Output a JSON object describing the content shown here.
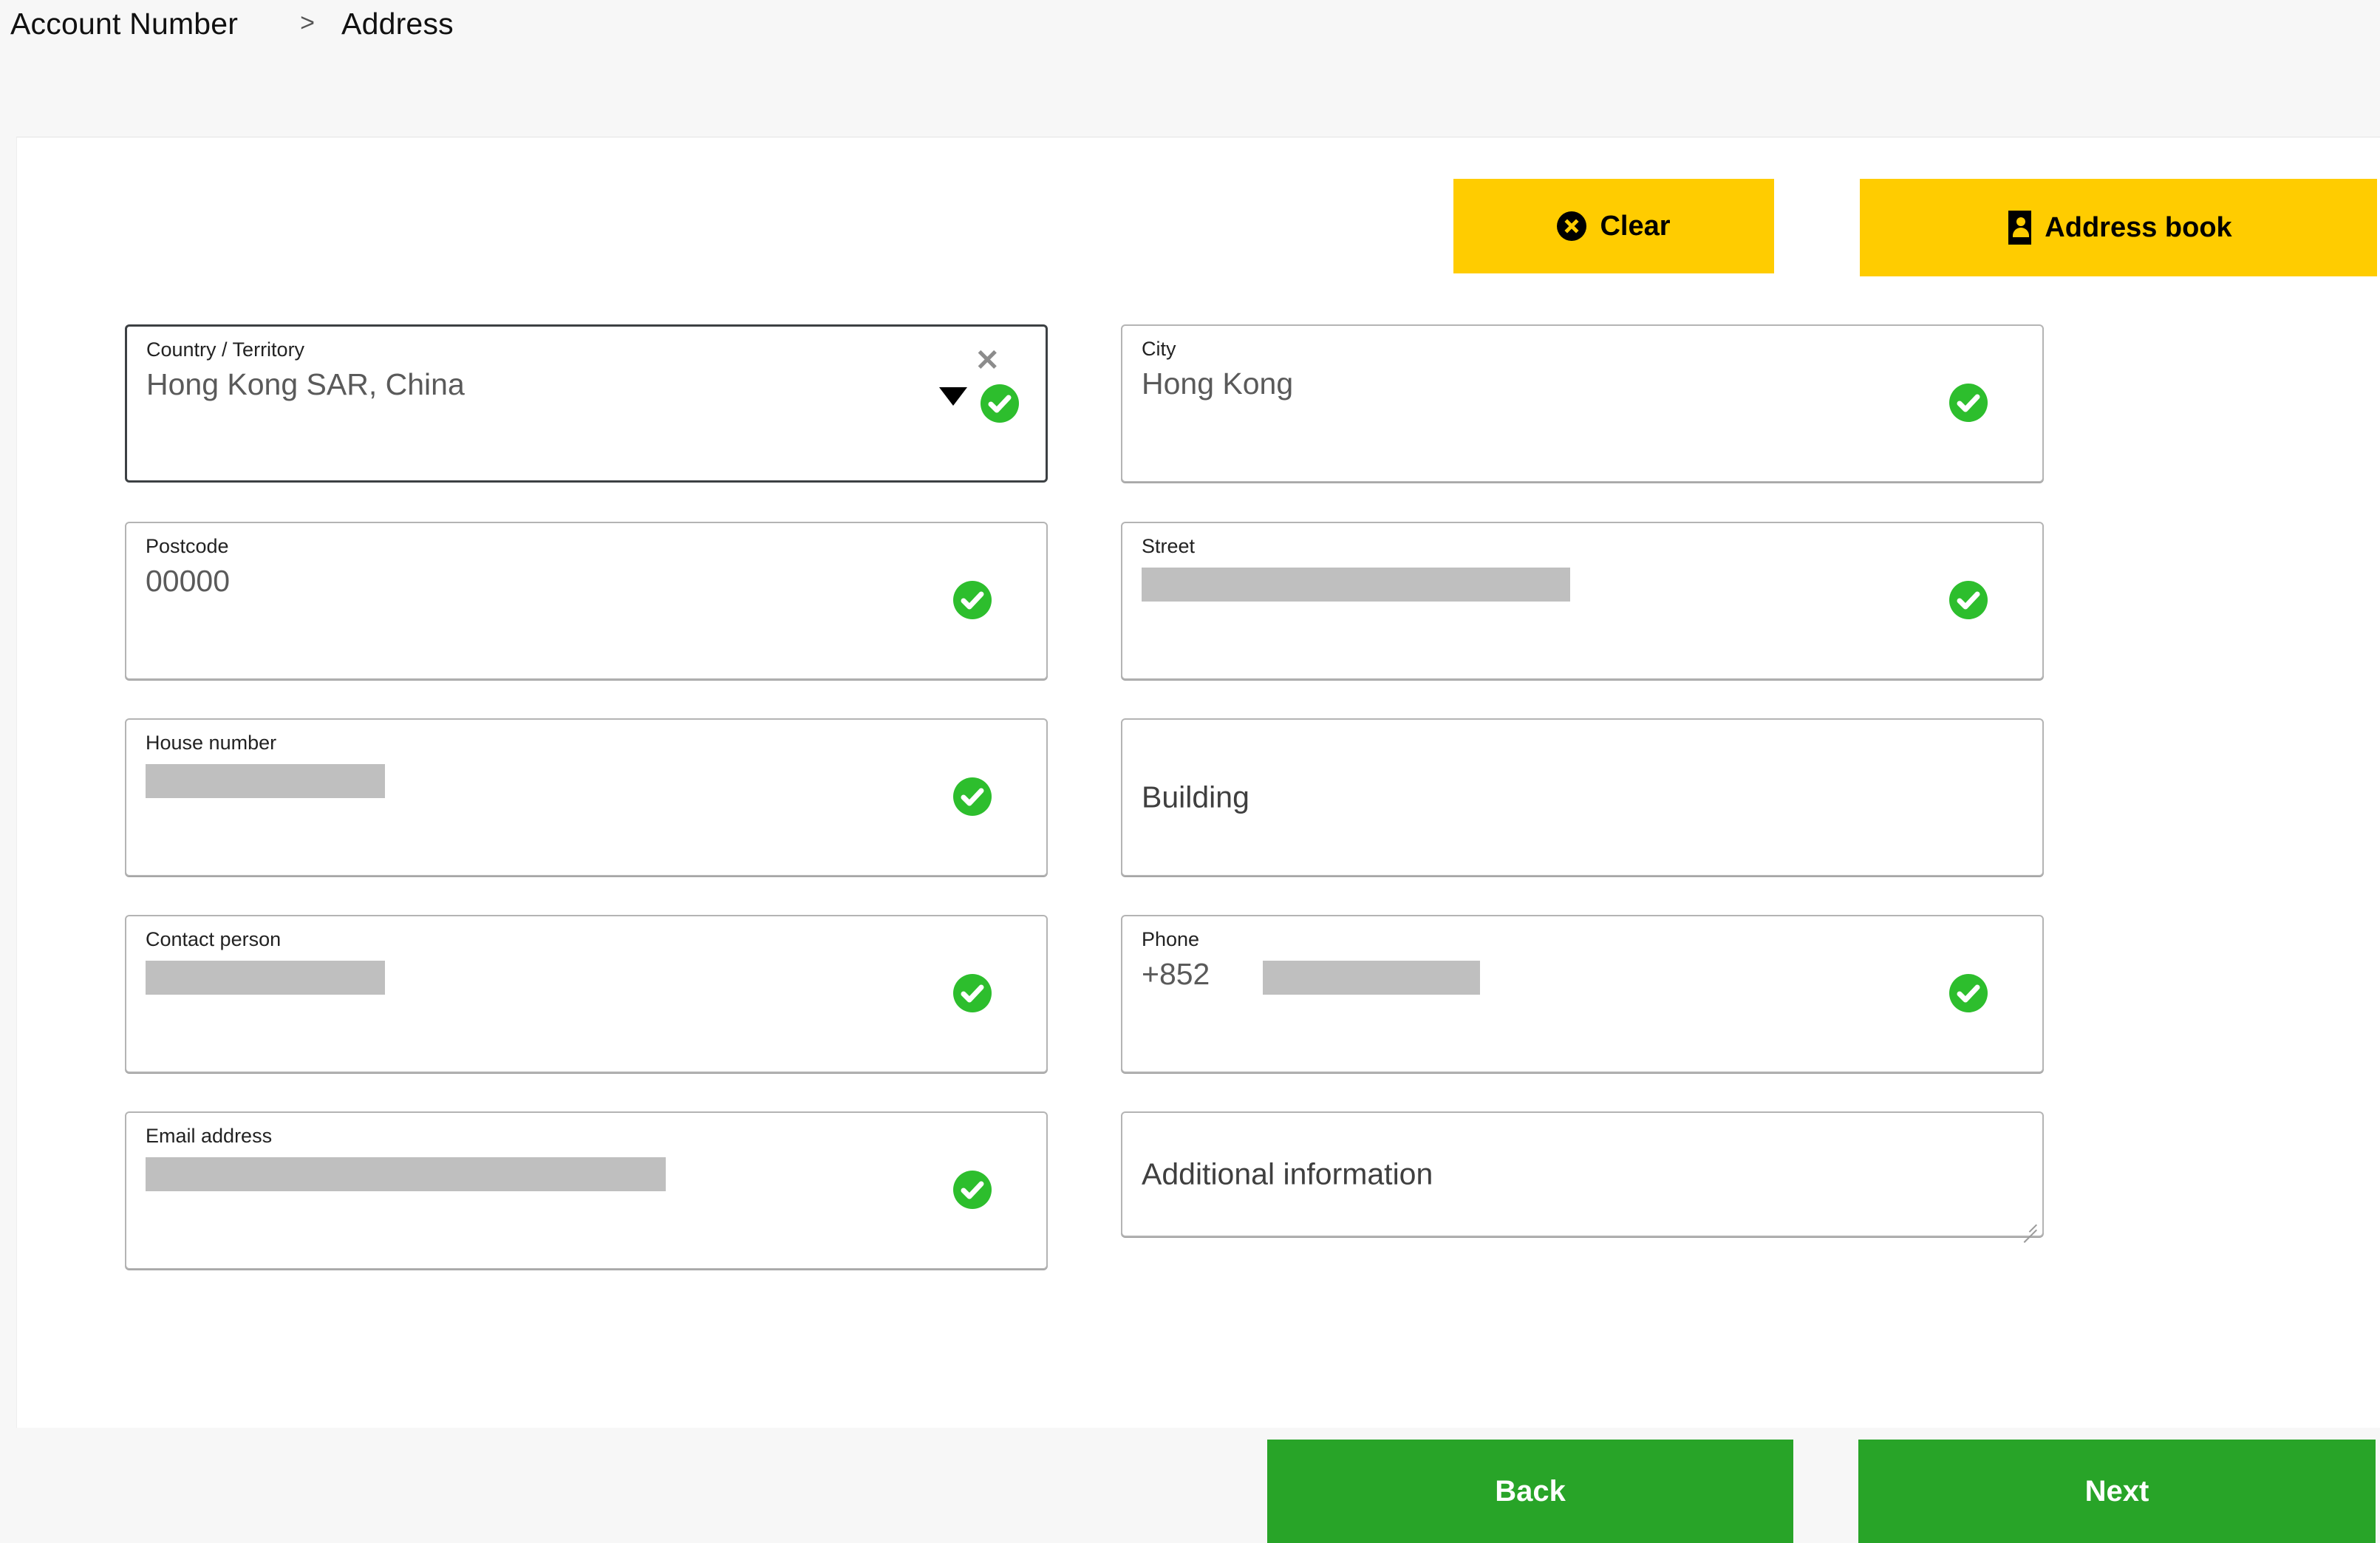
{
  "breadcrumb": {
    "items": [
      "Account Number",
      "Address"
    ],
    "separator": ">"
  },
  "toolbar": {
    "clear_label": "Clear",
    "clear_icon": "x-circle-icon",
    "address_book_label": "Address book",
    "address_book_icon": "address-book-icon"
  },
  "colors": {
    "accent_yellow": "#FFCC00",
    "accent_green": "#28A428",
    "valid_green": "#2DBE2D",
    "page_background": "#F7F7F7",
    "card_background": "#FFFFFF",
    "redaction_grey": "#BFBFBF",
    "field_border": "#B4B4B4",
    "field_border_focused": "#3C4043"
  },
  "form": {
    "fields": [
      {
        "name": "country-territory",
        "label": "Country / Territory",
        "value": "Hong Kong SAR, China",
        "redacted": false,
        "valid": true,
        "focused": true,
        "has_dropdown": true,
        "has_clear": true,
        "clear_icon": "close-x-icon",
        "dropdown_icon": "chevron-down-icon",
        "validation_icon": "check-circle-icon"
      },
      {
        "name": "city",
        "label": "City",
        "value": "Hong Kong",
        "redacted": false,
        "valid": true,
        "focused": false,
        "validation_icon": "check-circle-icon"
      },
      {
        "name": "postcode",
        "label": "Postcode",
        "value": "00000",
        "redacted": false,
        "valid": true,
        "focused": false,
        "validation_icon": "check-circle-icon"
      },
      {
        "name": "street",
        "label": "Street",
        "value": "",
        "redacted": true,
        "valid": true,
        "focused": false,
        "validation_icon": "check-circle-icon"
      },
      {
        "name": "house-number",
        "label": "House number",
        "value": "",
        "redacted": true,
        "valid": true,
        "focused": false,
        "validation_icon": "check-circle-icon"
      },
      {
        "name": "building",
        "label": "",
        "placeholder": "Building",
        "value": "",
        "redacted": false,
        "valid": false,
        "focused": false
      },
      {
        "name": "contact-person",
        "label": "Contact person",
        "value": "",
        "redacted": true,
        "valid": true,
        "focused": false,
        "validation_icon": "check-circle-icon"
      },
      {
        "name": "phone",
        "label": "Phone",
        "value": "+852",
        "redacted": true,
        "valid": true,
        "focused": false,
        "validation_icon": "check-circle-icon"
      },
      {
        "name": "email-address",
        "label": "Email address",
        "value": "",
        "redacted": true,
        "valid": true,
        "focused": false,
        "validation_icon": "check-circle-icon"
      },
      {
        "name": "additional-information",
        "label": "",
        "placeholder": "Additional information",
        "value": "",
        "redacted": false,
        "valid": false,
        "focused": false,
        "is_textarea": true,
        "resize_icon": "resize-handle-icon"
      }
    ]
  },
  "navigation": {
    "back_label": "Back",
    "next_label": "Next"
  }
}
